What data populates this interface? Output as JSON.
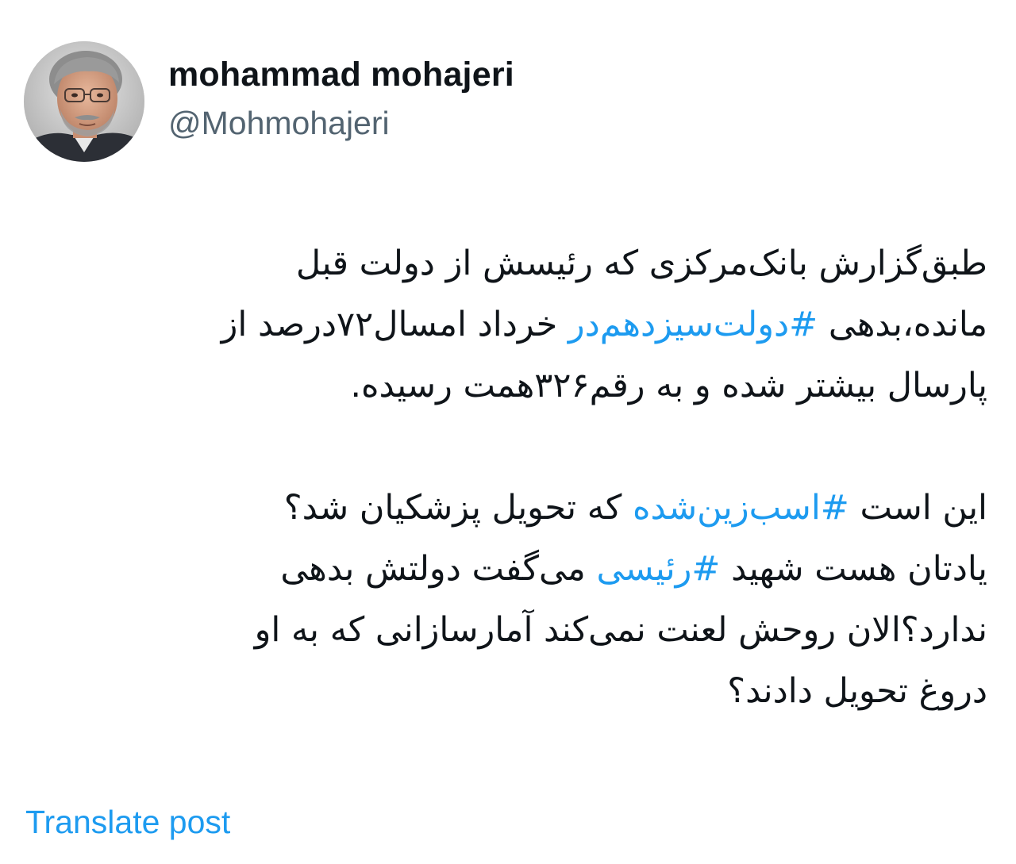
{
  "author": {
    "display_name": "mohammad mohajeri",
    "handle": "@Mohmohajeri"
  },
  "post": {
    "paragraph_1": {
      "line_1": "طبق‌گزارش بانک‌مرکزی که رئیسش از دولت قبل",
      "line_2_before": "مانده،بدهی ",
      "line_2_hashtag": "#دولت‌سیزدهم‌در",
      "line_2_after": " خرداد امسال۷۲درصد از",
      "line_3": "پارسال بیشتر شده و به رقم۳۲۶همت رسیده."
    },
    "paragraph_2": {
      "line_1_before": "این است ",
      "line_1_hashtag": "#اسب‌زین‌شده",
      "line_1_after": " که تحویل پزشکیان شد؟",
      "line_2_before": "یادتان هست شهید ",
      "line_2_hashtag": "#رئیسی",
      "line_2_after": " می‌گفت دولتش بدهی",
      "line_3": "ندارد؟الان روحش لعنت نمی‌کند آمارسازانی که به او",
      "line_4": "دروغ تحویل دادند؟"
    }
  },
  "actions": {
    "translate_label": "Translate post"
  },
  "colors": {
    "text": "#0f1419",
    "secondary_text": "#536471",
    "link": "#1d9bf0"
  }
}
